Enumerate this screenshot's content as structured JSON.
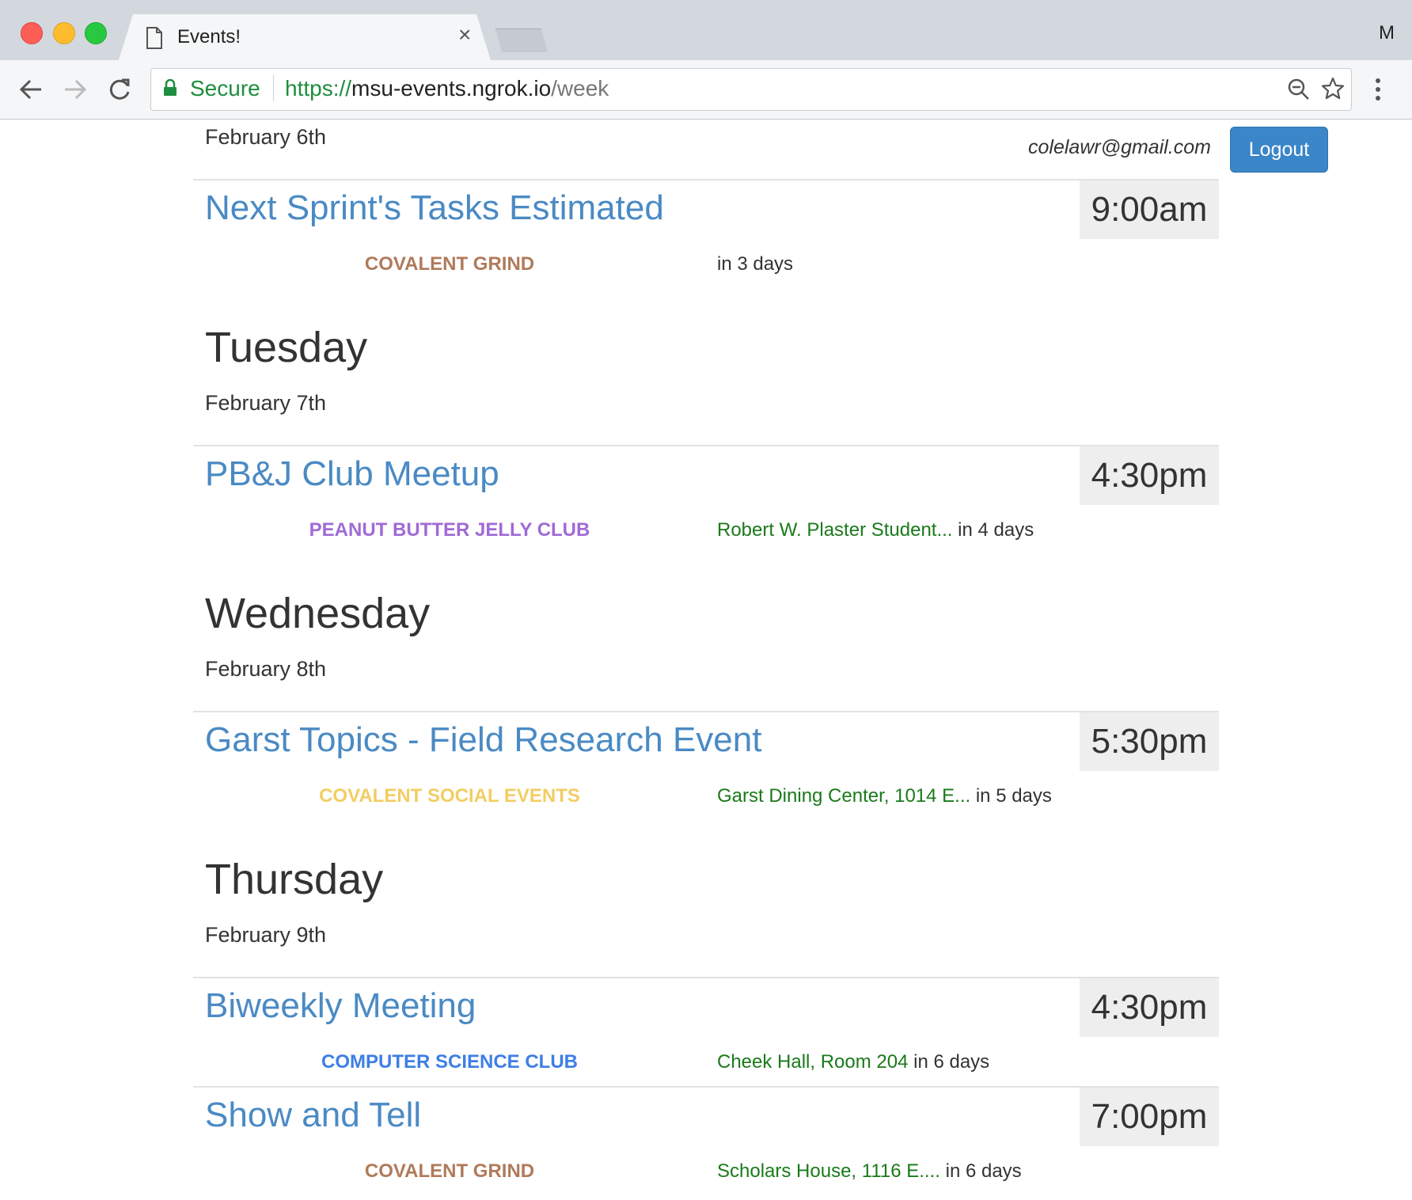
{
  "browser": {
    "tab_title": "Events!",
    "tab_close": "×",
    "profile_letter": "M",
    "secure_label": "Secure",
    "url_scheme": "https://",
    "url_host": "msu-events.ngrok.io",
    "url_path": "/week"
  },
  "header": {
    "first_date": "February 6th",
    "user_email": "colelawr@gmail.com",
    "logout_label": "Logout"
  },
  "days": [
    {
      "name": "Tuesday",
      "date": "February 7th"
    },
    {
      "name": "Wednesday",
      "date": "February 8th"
    },
    {
      "name": "Thursday",
      "date": "February 9th"
    }
  ],
  "events": [
    {
      "title": "Next Sprint's Tasks Estimated",
      "time": "9:00am",
      "org": "COVALENT GRIND",
      "org_color": "#b07a5a",
      "location": "",
      "relative": "in 3 days"
    },
    {
      "title": "PB&J Club Meetup",
      "time": "4:30pm",
      "org": "PEANUT BUTTER JELLY CLUB",
      "org_color": "#a06ad6",
      "location": "Robert W. Plaster Student...",
      "relative": "in 4 days"
    },
    {
      "title": "Garst Topics - Field Research Event",
      "time": "5:30pm",
      "org": "COVALENT SOCIAL EVENTS",
      "org_color": "#f3cd63",
      "location": "Garst Dining Center, 1014 E...",
      "relative": "in 5 days"
    },
    {
      "title": "Biweekly Meeting",
      "time": "4:30pm",
      "org": "COMPUTER SCIENCE CLUB",
      "org_color": "#3e7ee6",
      "location": "Cheek Hall, Room 204",
      "relative": "in 6 days"
    },
    {
      "title": "Show and Tell",
      "time": "7:00pm",
      "org": "COVALENT GRIND",
      "org_color": "#b07a5a",
      "location": "Scholars House, 1116 E....",
      "relative": "in 6 days"
    }
  ]
}
